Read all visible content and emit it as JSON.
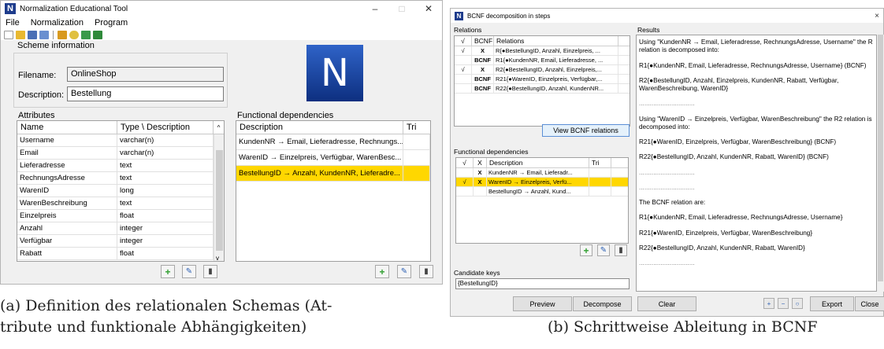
{
  "window_a": {
    "title": "Normalization Educational Tool",
    "menu": [
      "File",
      "Normalization",
      "Program"
    ],
    "scheme": {
      "group_label": "Scheme information",
      "filename_label": "Filename:",
      "filename_value": "OnlineShop",
      "description_label": "Description:",
      "description_value": "Bestellung"
    },
    "logo_letter": "N",
    "attributes": {
      "group_label": "Attributes",
      "columns": [
        "Name",
        "Type \\ Description"
      ],
      "rows": [
        [
          "Username",
          "varchar(n)"
        ],
        [
          "Email",
          "varchar(n)"
        ],
        [
          "Lieferadresse",
          "text"
        ],
        [
          "RechnungsAdresse",
          "text"
        ],
        [
          "WarenID",
          "long"
        ],
        [
          "WarenBeschreibung",
          "text"
        ],
        [
          "Einzelpreis",
          "float"
        ],
        [
          "Anzahl",
          "integer"
        ],
        [
          "Verfügbar",
          "integer"
        ],
        [
          "Rabatt",
          "float"
        ]
      ]
    },
    "fds": {
      "group_label": "Functional dependencies",
      "columns": [
        "Description",
        "Tri"
      ],
      "rows": [
        [
          "KundenNR → Email, Lieferadresse, Rechnungs...",
          ""
        ],
        [
          "WarenID → Einzelpreis, Verfügbar, WarenBesc...",
          ""
        ],
        [
          "BestellungID → Anzahl, KundenNR, Lieferadre...",
          ""
        ]
      ],
      "selected_row": 2
    },
    "caption": "(a) Definition des relationalen Schemas (Attribute und funktionale Abhängigkeiten)",
    "caption_line1": "(a) Definition des relationalen Schemas (At-",
    "caption_line2": "tribute und funktionale Abhängigkeiten)"
  },
  "window_b": {
    "title": "BCNF decomposition in steps",
    "relations": {
      "group_label": "Relations",
      "columns": [
        "√",
        "BCNF",
        "Relations"
      ],
      "rows": [
        [
          "√",
          "X",
          "R{●BestellungID, Anzahl, Einzelpreis, ..."
        ],
        [
          "",
          "BCNF",
          "R1{●KundenNR, Email, Lieferadresse, ..."
        ],
        [
          "√",
          "X",
          "R2{●BestellungID, Anzahl, Einzelpreis,..."
        ],
        [
          "",
          "BCNF",
          "R21{●WarenID, Einzelpreis, Verfügbar,..."
        ],
        [
          "",
          "BCNF",
          "R22{●BestellungID, Anzahl, KundenNR..."
        ]
      ],
      "view_button": "View BCNF relations"
    },
    "fds": {
      "group_label": "Functional dependencies",
      "columns": [
        "√",
        "X",
        "Description",
        "Tri"
      ],
      "rows": [
        [
          "",
          "X",
          "KundenNR → Email, Lieferadr...",
          ""
        ],
        [
          "√",
          "X",
          "WarenID → Einzelpreis, Verfü...",
          ""
        ],
        [
          "",
          "",
          "BestellungID → Anzahl, Kund...",
          ""
        ]
      ],
      "selected_row": 1
    },
    "candidate_keys": {
      "label": "Candidate keys",
      "value": "{BestellungID}"
    },
    "results": {
      "label": "Results",
      "paragraphs": [
        "Using \"KundenNR → Email, Lieferadresse, RechnungsAdresse, Username\" the R relation is decomposed into:",
        "R1{●KundenNR, Email, Lieferadresse, RechnungsAdresse, Username} (BCNF)",
        "R2{●BestellungID, Anzahl, Einzelpreis, KundenNR, Rabatt, Verfügbar, WarenBeschreibung, WarenID}",
        "...............................",
        "Using \"WarenID → Einzelpreis, Verfügbar, WarenBeschreibung\" the R2 relation is decomposed into:",
        "R21{●WarenID, Einzelpreis, Verfügbar, WarenBeschreibung}   (BCNF)",
        "R22{●BestellungID, Anzahl, KundenNR, Rabatt, WarenID}   (BCNF)",
        "...............................",
        "...............................",
        "The BCNF relation are:",
        "R1{●KundenNR, Email, Lieferadresse, RechnungsAdresse, Username}",
        "R21{●WarenID, Einzelpreis, Verfügbar, WarenBeschreibung}",
        "R22{●BestellungID, Anzahl, KundenNR, Rabatt, WarenID}",
        "..............................."
      ]
    },
    "buttons": {
      "preview": "Preview",
      "decompose": "Decompose",
      "clear": "Clear",
      "export": "Export",
      "close": "Close"
    },
    "caption": "(b) Schrittweise Ableitung in BCNF"
  },
  "colors": {
    "selected_row": "#ffd700",
    "logo_blue": "#1e4aa8",
    "window_bg": "#f0f0f0"
  }
}
